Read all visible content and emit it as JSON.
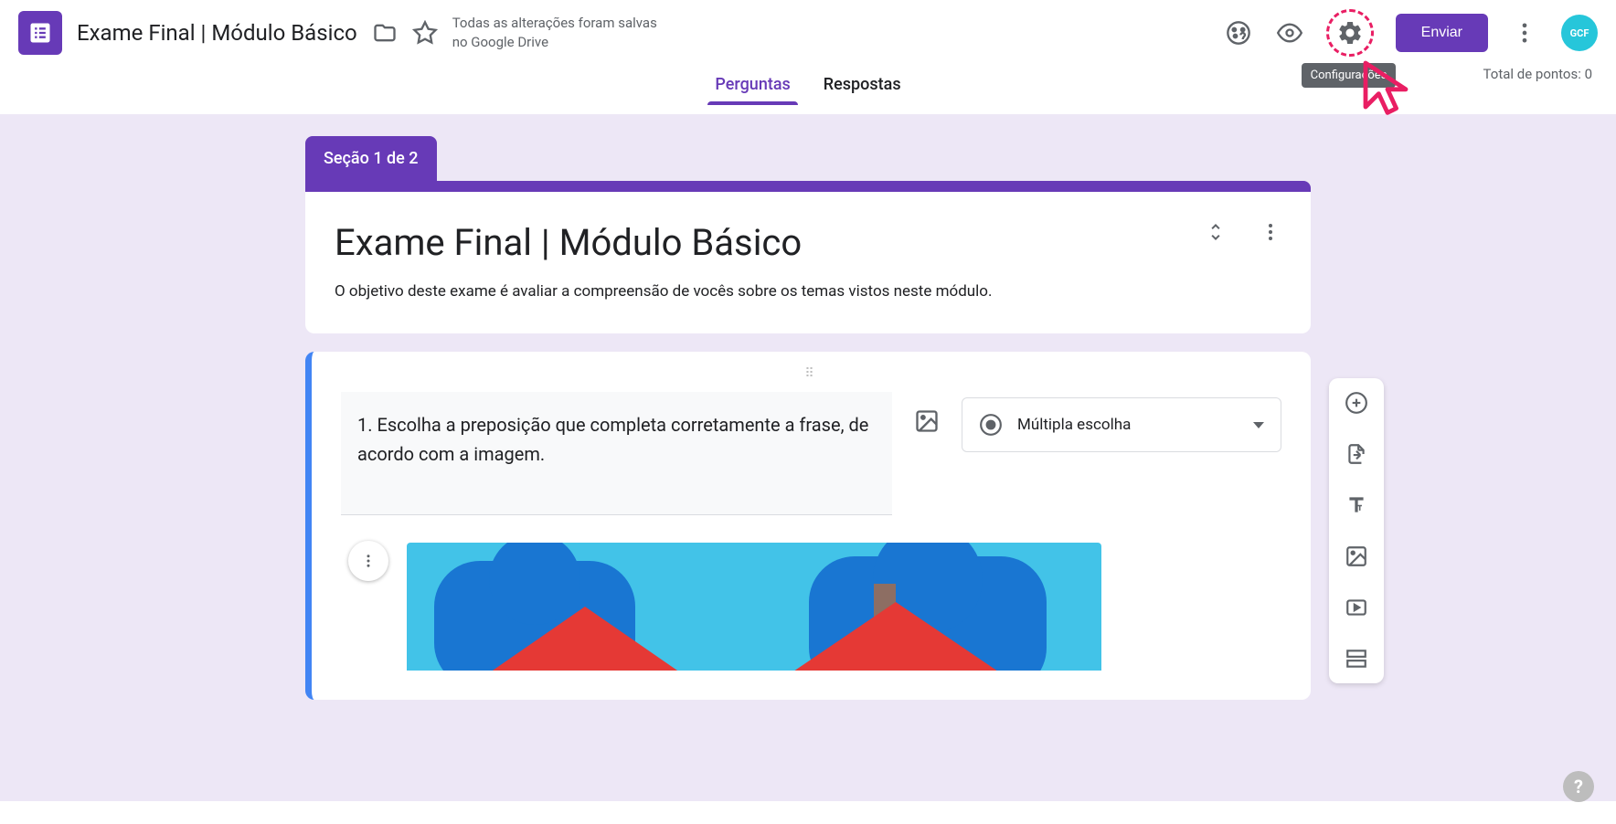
{
  "header": {
    "doc_title": "Exame Final | Módulo Básico",
    "save_status": "Todas as alterações foram salvas no Google Drive",
    "settings_tooltip": "Configurações",
    "send_button": "Enviar",
    "avatar_text": "GCF"
  },
  "tabs": {
    "questions": "Perguntas",
    "responses": "Respostas",
    "points_total": "Total de pontos: 0"
  },
  "section": {
    "tab_label": "Seção 1 de 2",
    "title": "Exame Final | Módulo Básico",
    "description": "O objetivo deste exame é avaliar a compreensão de vocês sobre os temas vistos neste módulo."
  },
  "question": {
    "text": "1. Escolha a preposição que completa corretamente a frase, de acordo com a imagem.",
    "type_label": "Múltipla escolha"
  }
}
